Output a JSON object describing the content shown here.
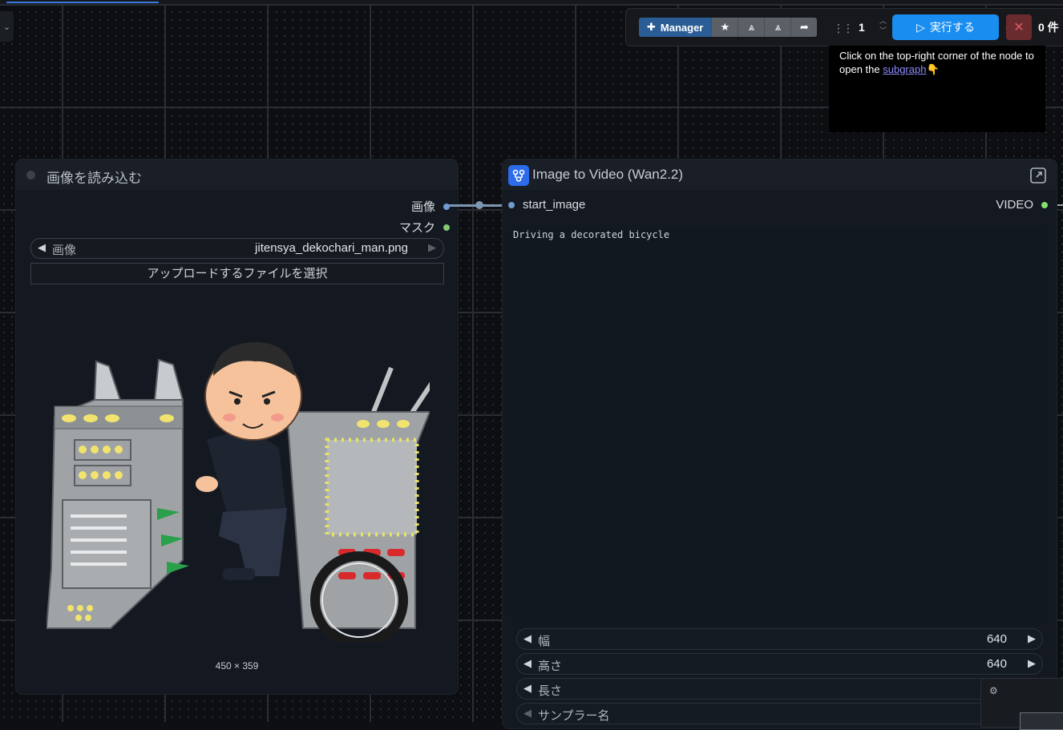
{
  "toolbar": {
    "manager_label": "Manager",
    "queue_count": "1",
    "run_label": "実行する",
    "queue_status": "0 件"
  },
  "tip": {
    "text": "Click on the top-right corner of the node to open the",
    "link": "subgraph",
    "emoji": "👇"
  },
  "load_node": {
    "title": "画像を読み込む",
    "outputs": [
      {
        "label": "画像",
        "color": "#6f9bd1"
      },
      {
        "label": "マスク",
        "color": "#83c873"
      }
    ],
    "image_widget": {
      "label": "画像",
      "value": "jitensya_dekochari_man.png"
    },
    "upload_label": "アップロードするファイルを選択",
    "dims": "450 × 359"
  },
  "video_node": {
    "title": "Image to Video (Wan2.2)",
    "input_label": "start_image",
    "output_label": "VIDEO",
    "prompt": "Driving a decorated bicycle",
    "widgets": [
      {
        "label": "幅",
        "value": "640"
      },
      {
        "label": "高さ",
        "value": "640"
      },
      {
        "label": "長さ",
        "value": ""
      },
      {
        "label": "サンプラー名",
        "value": ""
      }
    ]
  }
}
